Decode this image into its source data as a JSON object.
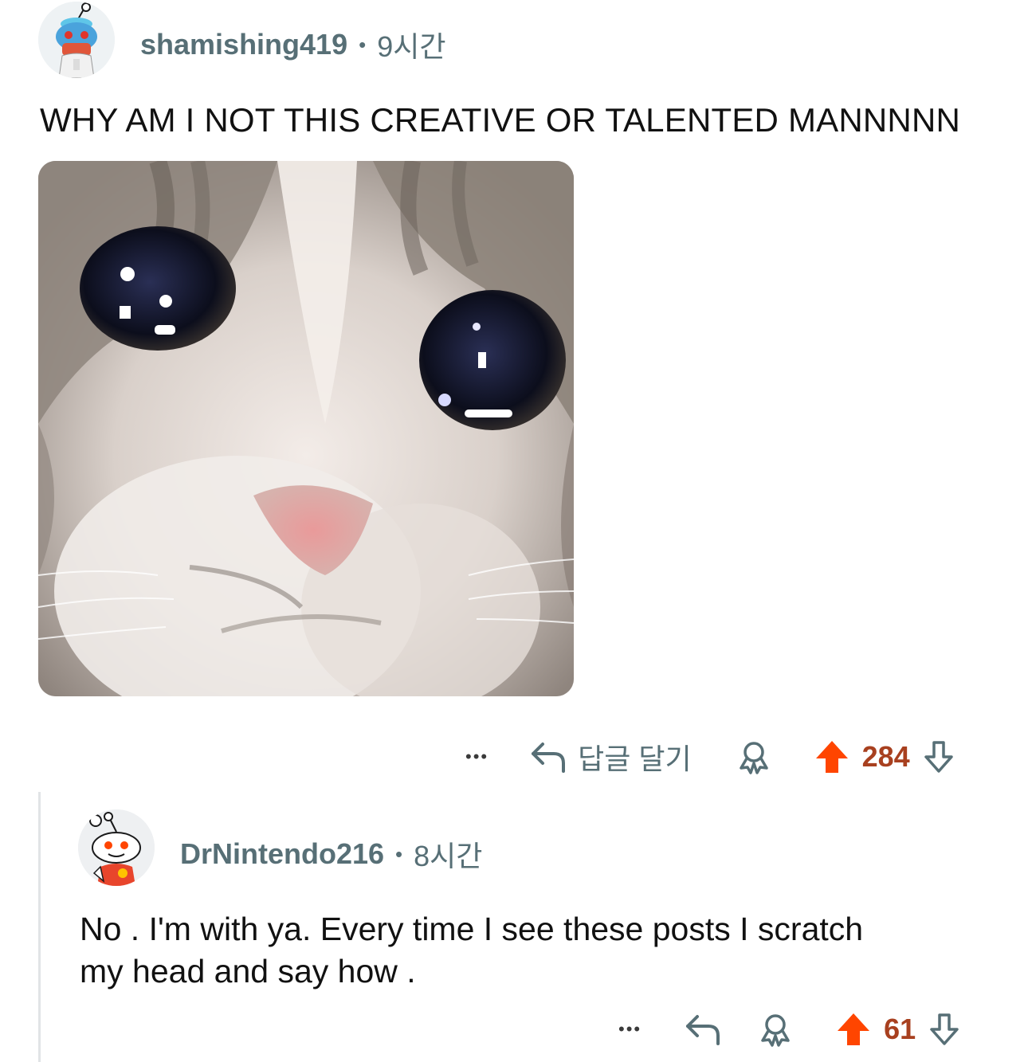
{
  "comments": [
    {
      "username": "shamishing419",
      "separator": "•",
      "time": "9시간",
      "body": "WHY AM I NOT THIS CREATIVE OR TALENTED MANNNNN",
      "media": {
        "description_icon": "crying-cat-image"
      },
      "actions": {
        "more": "•••",
        "reply_label": "답글 달기",
        "votes": "284"
      }
    },
    {
      "username": "DrNintendo216",
      "separator": "•",
      "time": "8시간",
      "body_line1": "No . I'm with ya. Every time I see these posts I scratch",
      "body_line2": "my head and say how .",
      "actions": {
        "more": "•••",
        "votes": "61"
      }
    }
  ],
  "colors": {
    "upvote": "#ff4500",
    "vote_count": "#a8401f",
    "meta": "#576f76",
    "thread_line": "#e1e4e6"
  }
}
